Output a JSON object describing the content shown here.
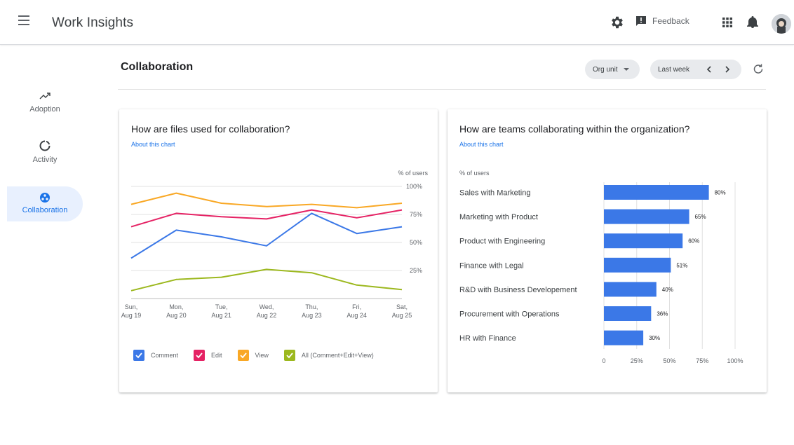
{
  "header": {
    "app_title": "Work Insights",
    "feedback_label": "Feedback",
    "icons": [
      "menu-icon",
      "settings-icon",
      "feedback-icon",
      "apps-icon",
      "notifications-icon",
      "avatar"
    ]
  },
  "sidebar": {
    "items": [
      {
        "label": "Adoption",
        "icon": "trending-up-icon",
        "active": false
      },
      {
        "label": "Activity",
        "icon": "activity-ring-icon",
        "active": false
      },
      {
        "label": "Collaboration",
        "icon": "collaboration-icon",
        "active": true
      }
    ]
  },
  "page": {
    "title": "Collaboration",
    "org_filter_label": "Org unit",
    "period_label": "Last week"
  },
  "colors": {
    "accent": "#1a73e8",
    "comment": "#3b78e7",
    "edit": "#e52264",
    "view": "#f9a825",
    "all": "#9cb81e"
  },
  "cards": {
    "files": {
      "title": "How are files used for collaboration?",
      "link": "About this chart"
    },
    "teams": {
      "title": "How are teams collaborating within the organization?",
      "link": "About this chart"
    }
  },
  "chart_data": [
    {
      "type": "line",
      "title": "How are files used for collaboration?",
      "ylabel": "% of users",
      "ylim": [
        0,
        100
      ],
      "yticks": [
        "25%",
        "50%",
        "75%",
        "100%"
      ],
      "categories": [
        [
          "Sun,",
          "Aug 19"
        ],
        [
          "Mon,",
          "Aug 20"
        ],
        [
          "Tue,",
          "Aug 21"
        ],
        [
          "Wed,",
          "Aug 22"
        ],
        [
          "Thu,",
          "Aug 23"
        ],
        [
          "Fri,",
          "Aug 24"
        ],
        [
          "Sat,",
          "Aug 25"
        ]
      ],
      "grid": true,
      "legend_position": "bottom",
      "series": [
        {
          "name": "Comment",
          "values": [
            36,
            61,
            55,
            47,
            76,
            58,
            64
          ],
          "color": "#3b78e7"
        },
        {
          "name": "Edit",
          "values": [
            64,
            76,
            73,
            71,
            79,
            72,
            79
          ],
          "color": "#e52264"
        },
        {
          "name": "View",
          "values": [
            84,
            94,
            85,
            82,
            84,
            81,
            85
          ],
          "color": "#f9a825"
        },
        {
          "name": "All (Comment+Edit+View)",
          "values": [
            7,
            17,
            19,
            26,
            23,
            12,
            8
          ],
          "color": "#9cb81e"
        }
      ]
    },
    {
      "type": "bar",
      "orientation": "horizontal",
      "title": "How are teams collaborating within the organization?",
      "ylabel": "% of users",
      "xlim": [
        0,
        100
      ],
      "xticks": [
        "0",
        "25%",
        "50%",
        "75%",
        "100%"
      ],
      "grid": true,
      "categories": [
        "Sales with Marketing",
        "Marketing with Product",
        "Product with Engineering",
        "Finance with Legal",
        "R&D with Business Developement",
        "Procurement with Operations",
        "HR with Finance"
      ],
      "values": [
        80,
        65,
        60,
        51,
        40,
        36,
        30
      ],
      "labels": [
        "80%",
        "65%",
        "60%",
        "51%",
        "40%",
        "36%",
        "30%"
      ],
      "color": "#3b78e7"
    }
  ]
}
